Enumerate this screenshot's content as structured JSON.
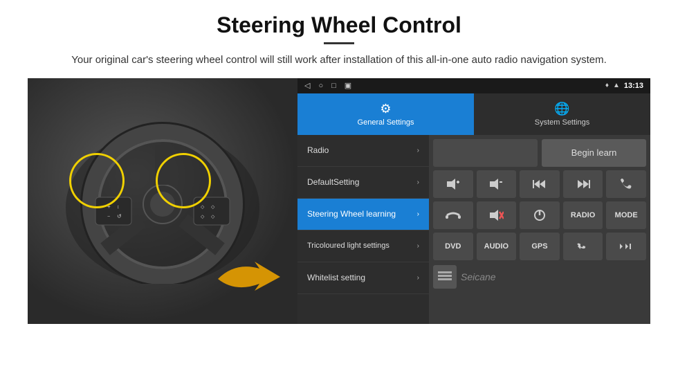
{
  "page": {
    "title": "Steering Wheel Control",
    "subtitle": "Your original car's steering wheel control will still work after installation of this all-in-one auto radio navigation system."
  },
  "status_bar": {
    "time": "13:13",
    "icons": [
      "◁",
      "○",
      "□",
      "▣"
    ]
  },
  "tabs": {
    "general": {
      "label": "General Settings",
      "icon": "⚙"
    },
    "system": {
      "label": "System Settings",
      "icon": "🌐"
    }
  },
  "menu_items": [
    {
      "label": "Radio",
      "active": false
    },
    {
      "label": "DefaultSetting",
      "active": false
    },
    {
      "label": "Steering Wheel learning",
      "active": true
    },
    {
      "label": "Tricoloured light settings",
      "active": false
    },
    {
      "label": "Whitelist setting",
      "active": false
    }
  ],
  "begin_learn_btn": "Begin learn",
  "control_buttons": {
    "row1": [
      "🔊+",
      "🔊−",
      "⏮",
      "⏭",
      "📞"
    ],
    "row2": [
      "↩",
      "🔇",
      "⏻",
      "RADIO",
      "MODE"
    ],
    "row3": [
      "DVD",
      "AUDIO",
      "GPS",
      "📞⏮",
      "↙⏭"
    ]
  },
  "watermark": "Seicane"
}
